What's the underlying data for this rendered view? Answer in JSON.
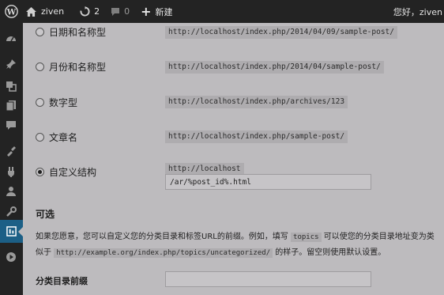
{
  "admin_bar": {
    "site_name": "ziven",
    "updates_count": "2",
    "comments_count": "0",
    "new_label": "新建",
    "account_label": "您好，ziven",
    "icons": [
      "wordpress-logo-icon",
      "home-icon",
      "refresh-icon",
      "comment-icon",
      "plus-icon"
    ]
  },
  "sidebar": {
    "icons": [
      "dashboard-icon",
      "pin-icon",
      "media-icon",
      "pages-icon",
      "comments-icon",
      "appearance-icon",
      "plugins-icon",
      "users-icon",
      "tools-icon",
      "settings-icon",
      "play-icon"
    ],
    "active": "settings-icon"
  },
  "permalink_options": [
    {
      "label": "日期和名称型",
      "example": "http://localhost/index.php/2014/04/09/sample-post/",
      "checked": false
    },
    {
      "label": "月份和名称型",
      "example": "http://localhost/index.php/2014/04/sample-post/",
      "checked": false
    },
    {
      "label": "数字型",
      "example": "http://localhost/index.php/archives/123",
      "checked": false
    },
    {
      "label": "文章名",
      "example": "http://localhost/index.php/sample-post/",
      "checked": false
    },
    {
      "label": "自定义结构",
      "example": "http://localhost",
      "checked": true
    }
  ],
  "custom_structure": {
    "value": "/ar/%post_id%.html"
  },
  "optional": {
    "title": "可选",
    "desc_part1": "如果您愿意，您可以自定义您的分类目录和标签URL的前缀。例如，填写 ",
    "desc_code1": "topics",
    "desc_part2": " 可以使您的分类目录地址变为类似于 ",
    "desc_code2": "http://example.org/index.php/topics/uncategorized/",
    "desc_part3": " 的样子。留空则使用默认设置。",
    "category_base_label": "分类目录前缀",
    "category_base_value": ""
  },
  "colors": {
    "background": "#bdbbbe",
    "adminbar": "#232323",
    "active_menu": "#1c5f86",
    "code_bg": "#aeacaf"
  }
}
